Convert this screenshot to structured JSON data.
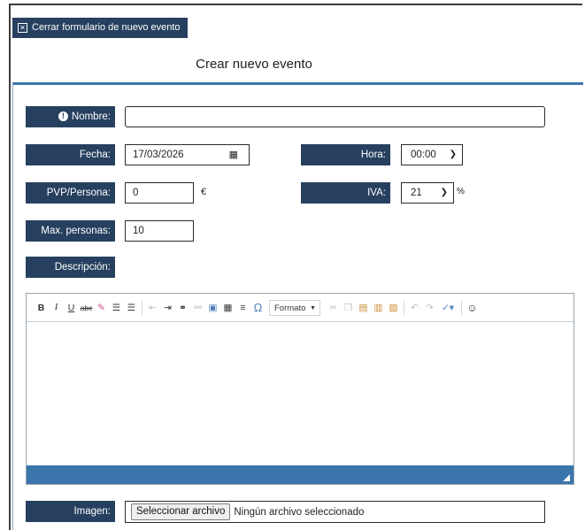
{
  "header": {
    "close_button_label": "Cerrar formulario de nuevo evento",
    "title": "Crear nuevo evento"
  },
  "form": {
    "nombre": {
      "label": "Nombre:",
      "value": ""
    },
    "fecha": {
      "label": "Fecha:",
      "value": "17/03/2026"
    },
    "hora": {
      "label": "Hora:",
      "value": "00:00"
    },
    "pvp": {
      "label": "PVP/Persona:",
      "value": "0",
      "suffix": "€"
    },
    "iva": {
      "label": "IVA:",
      "value": "21",
      "suffix": "%"
    },
    "max_personas": {
      "label": "Max. personas:",
      "value": "10"
    },
    "descripcion": {
      "label": "Descripción:"
    },
    "imagen": {
      "label": "Imagen:",
      "button_label": "Seleccionar archivo",
      "status": "Ningún archivo seleccionado"
    }
  },
  "editor": {
    "format_label": "Formato",
    "tools": {
      "bold": "B",
      "italic": "I",
      "underline": "U",
      "strike": "abc",
      "omega": "Ω"
    }
  },
  "colors": {
    "label_bg": "#27405f",
    "accent": "#3a75ab"
  }
}
